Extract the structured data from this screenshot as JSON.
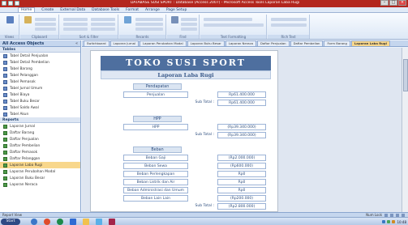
{
  "window": {
    "title": "DATABASE SUSI SPORT : Database (Access 2007) - Microsoft Access Tools Laporan Laba Rugi"
  },
  "ribbon": {
    "tabs": [
      "Home",
      "Create",
      "External Data",
      "Database Tools",
      "Format",
      "Arrange",
      "Page Setup"
    ],
    "groups": [
      "Views",
      "Clipboard",
      "Sort & Filter",
      "Records",
      "Find",
      "Text Formatting",
      "Rich Text"
    ]
  },
  "nav": {
    "title": "All Access Objects",
    "categories": {
      "tables": "Tables",
      "reports": "Reports"
    },
    "tables": [
      "Tabel Detail Penjualan",
      "Tabel Detail Pembelian",
      "Tabel Barang",
      "Tabel Pelanggan",
      "Tabel Pemasok",
      "Tabel Jurnal Umum",
      "Tabel Biaya",
      "Tabel Buku Besar",
      "Tabel Saldo Awal",
      "Tabel Akun"
    ],
    "reports": [
      "Laporan Jurnal",
      "Daftar Barang",
      "Daftar Penjualan",
      "Daftar Pembelian",
      "Daftar Pemasok",
      "Daftar Pelanggan",
      "Laporan Laba Rugi",
      "Laporan Perubahan Modal",
      "Laporan Buku Besar",
      "Laporan Neraca"
    ]
  },
  "doctabs": [
    "Switchboard",
    "Laporan Jurnal",
    "Laporan Perubahan Modal",
    "Laporan Buku Besar",
    "Laporan Neraca",
    "Daftar Penjualan",
    "Daftar Pembelian",
    "Form Barang",
    "Laporan Laba Rugi"
  ],
  "report": {
    "company": "TOKO SUSI SPORT",
    "title": "Laporan Laba Rugi",
    "pendapatan_header": "Pendapatan",
    "penjualan_label": "Penjualan",
    "penjualan_value": "Rp61.400.000",
    "subtotal_label": "Sub Total :",
    "pendapatan_subtotal": "Rp61.400.000",
    "hpp_header": "HPP",
    "hpp_label": "HPP",
    "hpp_value": "(Rp39.340.000)",
    "hpp_subtotal": "(Rp39.340.000)",
    "biaya_header": "Beban",
    "biaya_rows": [
      {
        "label": "Beban Gaji",
        "value": "(Rp2.000.000)"
      },
      {
        "label": "Beban Sewa",
        "value": "(Rp600.000)"
      },
      {
        "label": "Beban Perlengkapan",
        "value": "Rp0"
      },
      {
        "label": "Beban Listrik dan Air",
        "value": "Rp0"
      },
      {
        "label": "Beban Administrasi dan Umum",
        "value": "Rp0"
      },
      {
        "label": "Beban Lain Lain",
        "value": "(Rp200.000)"
      }
    ],
    "biaya_subtotal": "(Rp2.800.000)"
  },
  "status": {
    "left": "Report View",
    "right": "Num Lock"
  },
  "taskbar": {
    "start": "Start",
    "clock": "10:48"
  }
}
